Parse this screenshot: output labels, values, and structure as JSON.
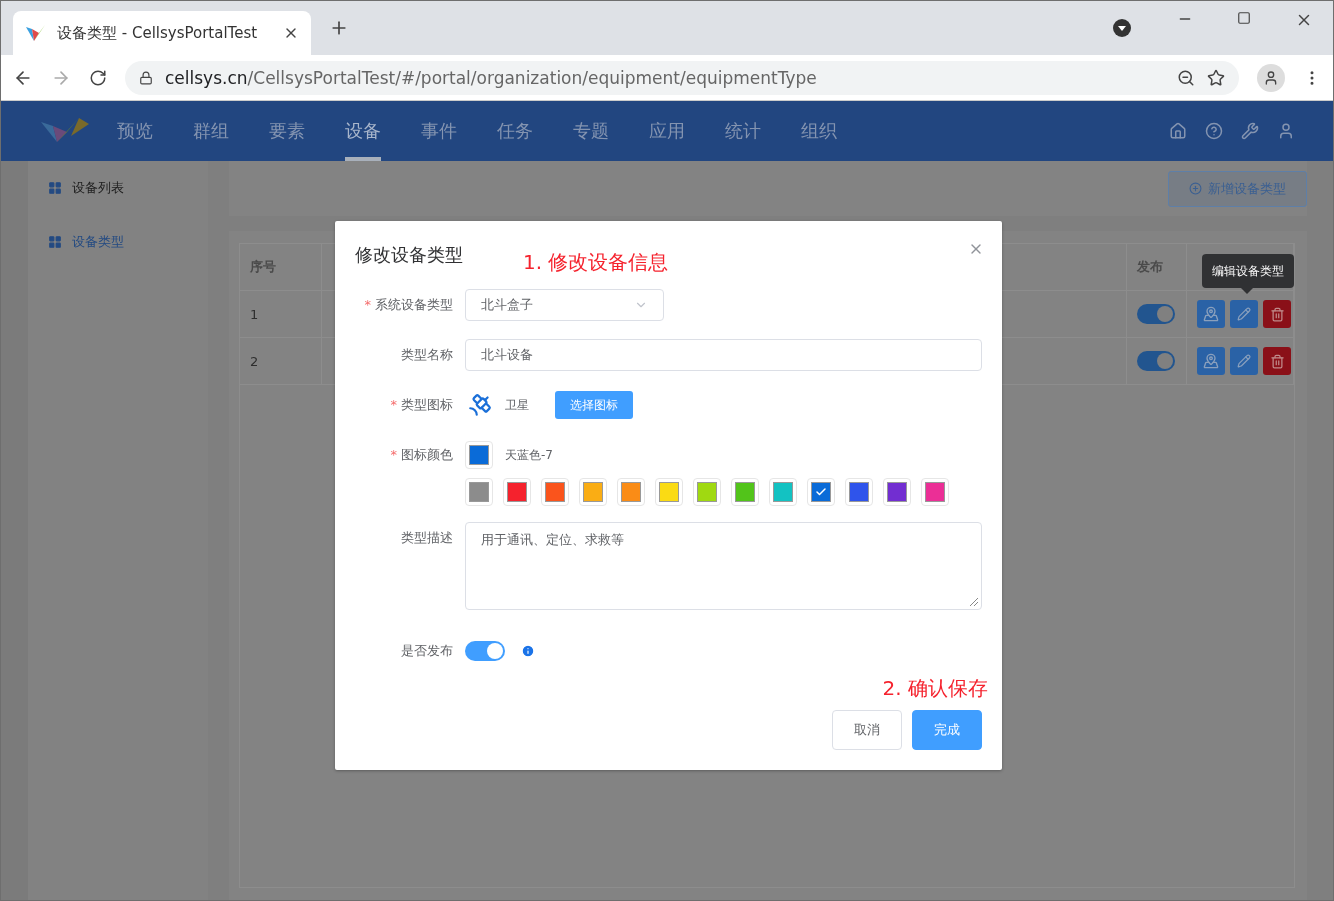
{
  "browser": {
    "tab_title": "设备类型 - CellsysPortalTest",
    "url_host": "cellsys.cn",
    "url_path": "/CellsysPortalTest/#/portal/organization/equipment/equipmentType"
  },
  "nav": {
    "items": [
      {
        "label": "预览",
        "selected": false
      },
      {
        "label": "群组",
        "selected": false
      },
      {
        "label": "要素",
        "selected": false
      },
      {
        "label": "设备",
        "selected": true
      },
      {
        "label": "事件",
        "selected": false
      },
      {
        "label": "任务",
        "selected": false
      },
      {
        "label": "专题",
        "selected": false
      },
      {
        "label": "应用",
        "selected": false
      },
      {
        "label": "统计",
        "selected": false
      },
      {
        "label": "组织",
        "selected": false
      }
    ]
  },
  "sidebar": {
    "items": [
      {
        "label": "设备列表",
        "selected": false
      },
      {
        "label": "设备类型",
        "selected": true
      }
    ]
  },
  "toolbar": {
    "add_button": "新增设备类型"
  },
  "table": {
    "columns": [
      "序号",
      "发布"
    ],
    "rows": [
      {
        "index": "1",
        "published": true
      },
      {
        "index": "2",
        "published": true
      }
    ]
  },
  "tooltip": "编辑设备类型",
  "dialog": {
    "title": "修改设备类型",
    "required_mark": "*",
    "annotations": [
      "1. 修改设备信息",
      "2. 确认保存"
    ],
    "system_type": {
      "label": "系统设备类型",
      "required": true,
      "value": "北斗盒子"
    },
    "name": {
      "label": "类型名称",
      "value": "北斗设备"
    },
    "icon": {
      "label": "类型图标",
      "required": true,
      "value": "卫星",
      "button": "选择图标"
    },
    "icon_color": {
      "label": "图标颜色",
      "required": true,
      "color": "#0a6bd8",
      "value": "天蓝色-7"
    },
    "swatches": [
      {
        "color": "#8c8c8c",
        "selected": false
      },
      {
        "color": "#f5222d",
        "selected": false
      },
      {
        "color": "#fa541c",
        "selected": false
      },
      {
        "color": "#faad14",
        "selected": false
      },
      {
        "color": "#fa8c16",
        "selected": false
      },
      {
        "color": "#fadb14",
        "selected": false
      },
      {
        "color": "#a0d911",
        "selected": false
      },
      {
        "color": "#52c41a",
        "selected": false
      },
      {
        "color": "#13c2c2",
        "selected": false
      },
      {
        "color": "#0a6bd8",
        "selected": true
      },
      {
        "color": "#2f54eb",
        "selected": false
      },
      {
        "color": "#722ed1",
        "selected": false
      },
      {
        "color": "#eb2f96",
        "selected": false
      }
    ],
    "description": {
      "label": "类型描述",
      "value": "用于通讯、定位、求救等"
    },
    "publish": {
      "label": "是否发布",
      "on": true
    },
    "buttons": {
      "cancel": "取消",
      "ok": "完成"
    }
  }
}
